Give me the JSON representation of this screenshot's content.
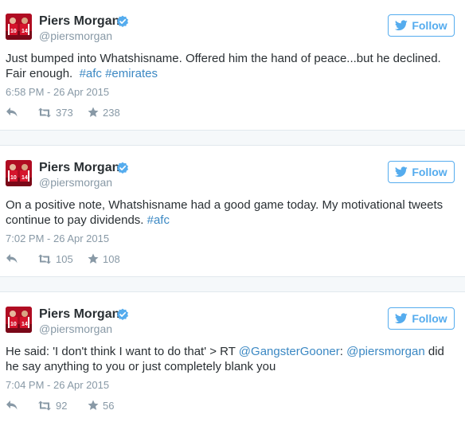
{
  "colors": {
    "link": "#3b88c3",
    "follow": "#55acee",
    "muted": "#8899a6",
    "text": "#292f33"
  },
  "icons": {
    "verified": "verified-badge-icon",
    "follow": "twitter-bird-icon",
    "reply": "reply-icon",
    "retweet": "retweet-icon",
    "favorite": "star-icon"
  },
  "tweets": [
    {
      "author": {
        "name": "Piers Morgan",
        "handle": "@piersmorgan",
        "avatar_jersey_numbers": [
          "10",
          "14"
        ]
      },
      "follow_label": "Follow",
      "text_segments": [
        {
          "text": "Just bumped into Whatshisname. Offered him the hand of peace...but he declined. Fair enough.  "
        },
        {
          "text": "#afc",
          "link": true
        },
        {
          "text": " "
        },
        {
          "text": "#emirates",
          "link": true
        }
      ],
      "timestamp": "6:58 PM - 26 Apr 2015",
      "retweets": "373",
      "favorites": "238"
    },
    {
      "author": {
        "name": "Piers Morgan",
        "handle": "@piersmorgan",
        "avatar_jersey_numbers": [
          "10",
          "14"
        ]
      },
      "follow_label": "Follow",
      "text_segments": [
        {
          "text": "On a positive note, Whatshisname had a good game today. My motivational tweets continue to pay dividends. "
        },
        {
          "text": "#afc",
          "link": true
        }
      ],
      "timestamp": "7:02 PM - 26 Apr 2015",
      "retweets": "105",
      "favorites": "108"
    },
    {
      "author": {
        "name": "Piers Morgan",
        "handle": "@piersmorgan",
        "avatar_jersey_numbers": [
          "10",
          "14"
        ]
      },
      "follow_label": "Follow",
      "text_segments": [
        {
          "text": "He said: 'I don't think I want to do that' > RT "
        },
        {
          "text": "@GangsterGooner",
          "link": true
        },
        {
          "text": ": "
        },
        {
          "text": "@piersmorgan",
          "link": true
        },
        {
          "text": " did he say anything to you or just completely blank you"
        }
      ],
      "timestamp": "7:04 PM - 26 Apr 2015",
      "retweets": "92",
      "favorites": "56"
    }
  ]
}
